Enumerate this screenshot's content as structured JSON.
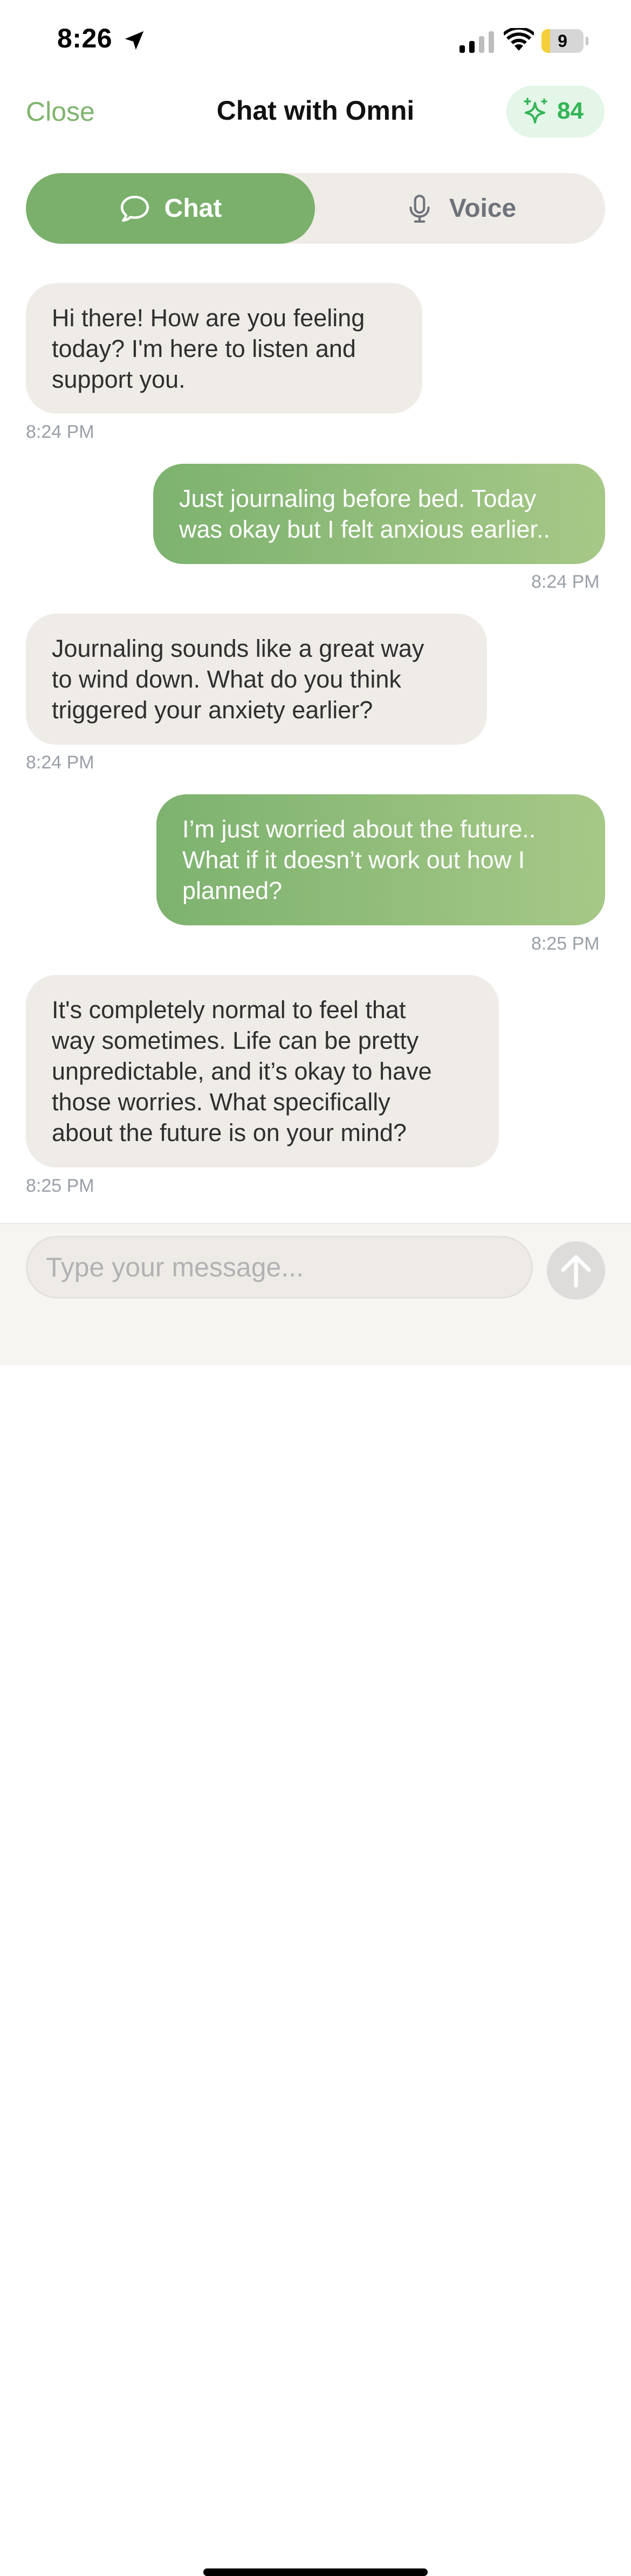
{
  "status_bar": {
    "time": "8:26",
    "battery_level": "9",
    "battery_fraction": 0.09,
    "icons": [
      "location-arrow-icon",
      "cellular-signal-icon",
      "wifi-icon",
      "battery-icon"
    ]
  },
  "header": {
    "close_label": "Close",
    "title": "Chat with Omni",
    "credits": "84",
    "credits_icon": "sparkle-icon"
  },
  "mode_tabs": [
    {
      "label": "Chat",
      "icon": "chat-bubble-icon",
      "selected": true
    },
    {
      "label": "Voice",
      "icon": "microphone-icon",
      "selected": false
    }
  ],
  "messages": [
    {
      "sender": "assistant",
      "text": "Hi there! How are you feeling\ntoday? I'm here to listen and\nsupport you.",
      "time": "8:24 PM"
    },
    {
      "sender": "user",
      "text": "Just journaling before bed. Today\nwas okay but I felt anxious earlier..",
      "time": "8:24 PM"
    },
    {
      "sender": "assistant",
      "text": "Journaling sounds like a great way\nto wind down. What do you think\ntriggered your anxiety earlier?",
      "time": "8:24 PM"
    },
    {
      "sender": "user",
      "text": "I’m just worried about the future..\nWhat if it doesn’t work out how I\nplanned?",
      "time": "8:25 PM"
    },
    {
      "sender": "assistant",
      "text": "It's completely normal to feel that\nway sometimes. Life can be pretty\nunpredictable, and it’s okay to have\nthose worries. What specifically\nabout the future is on your mind?",
      "time": "8:25 PM"
    }
  ],
  "composer": {
    "placeholder": "Type your message...",
    "value": "",
    "send_icon": "arrow-up-icon"
  },
  "colors": {
    "accent_green": "#7ab06b",
    "close_green": "#7fb46e",
    "credits_green": "#34b457",
    "incoming_bubble": "#efece8",
    "timestamp_gray": "#9aa0a8"
  }
}
